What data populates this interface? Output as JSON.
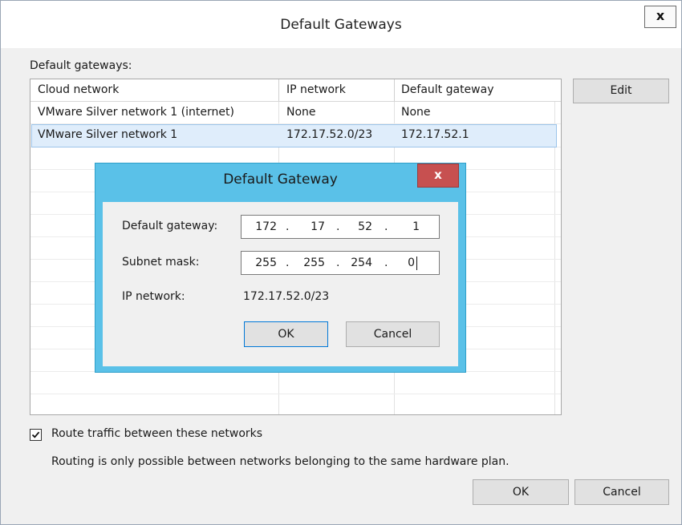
{
  "window": {
    "title": "Default Gateways",
    "close_glyph": "x",
    "section_label": "Default gateways:",
    "edit_label": "Edit",
    "ok_label": "OK",
    "cancel_label": "Cancel"
  },
  "table": {
    "columns": [
      "Cloud network",
      "IP network",
      "Default gateway"
    ],
    "rows": [
      {
        "cloud_network": "VMware Silver network 1 (internet)",
        "ip_network": "None",
        "default_gateway": "None"
      },
      {
        "cloud_network": "VMware Silver network 1",
        "ip_network": "172.17.52.0/23",
        "default_gateway": "172.17.52.1"
      }
    ],
    "selected_row": 1
  },
  "route_checkbox": {
    "label": "Route traffic between these networks",
    "checked": true,
    "note": "Routing is only possible between networks belonging to the same hardware plan."
  },
  "dialog": {
    "title": "Default Gateway",
    "close_glyph": "x",
    "gateway_label": "Default gateway:",
    "gateway_octets": [
      "172",
      "17",
      "52",
      "1"
    ],
    "subnet_label": "Subnet mask:",
    "subnet_octets": [
      "255",
      "255",
      "254",
      "0"
    ],
    "ip_network_label": "IP network:",
    "ip_network_value": "172.17.52.0/23",
    "ok_label": "OK",
    "cancel_label": "Cancel"
  },
  "icons": {
    "outer_close": "close-icon",
    "dialog_close": "close-icon",
    "checkbox": "checkmark-icon"
  },
  "colors": {
    "dialog_frame": "#5ac1e8",
    "dialog_close": "#c75050",
    "selection": "#dfedfb",
    "focus_border": "#0078d7"
  }
}
